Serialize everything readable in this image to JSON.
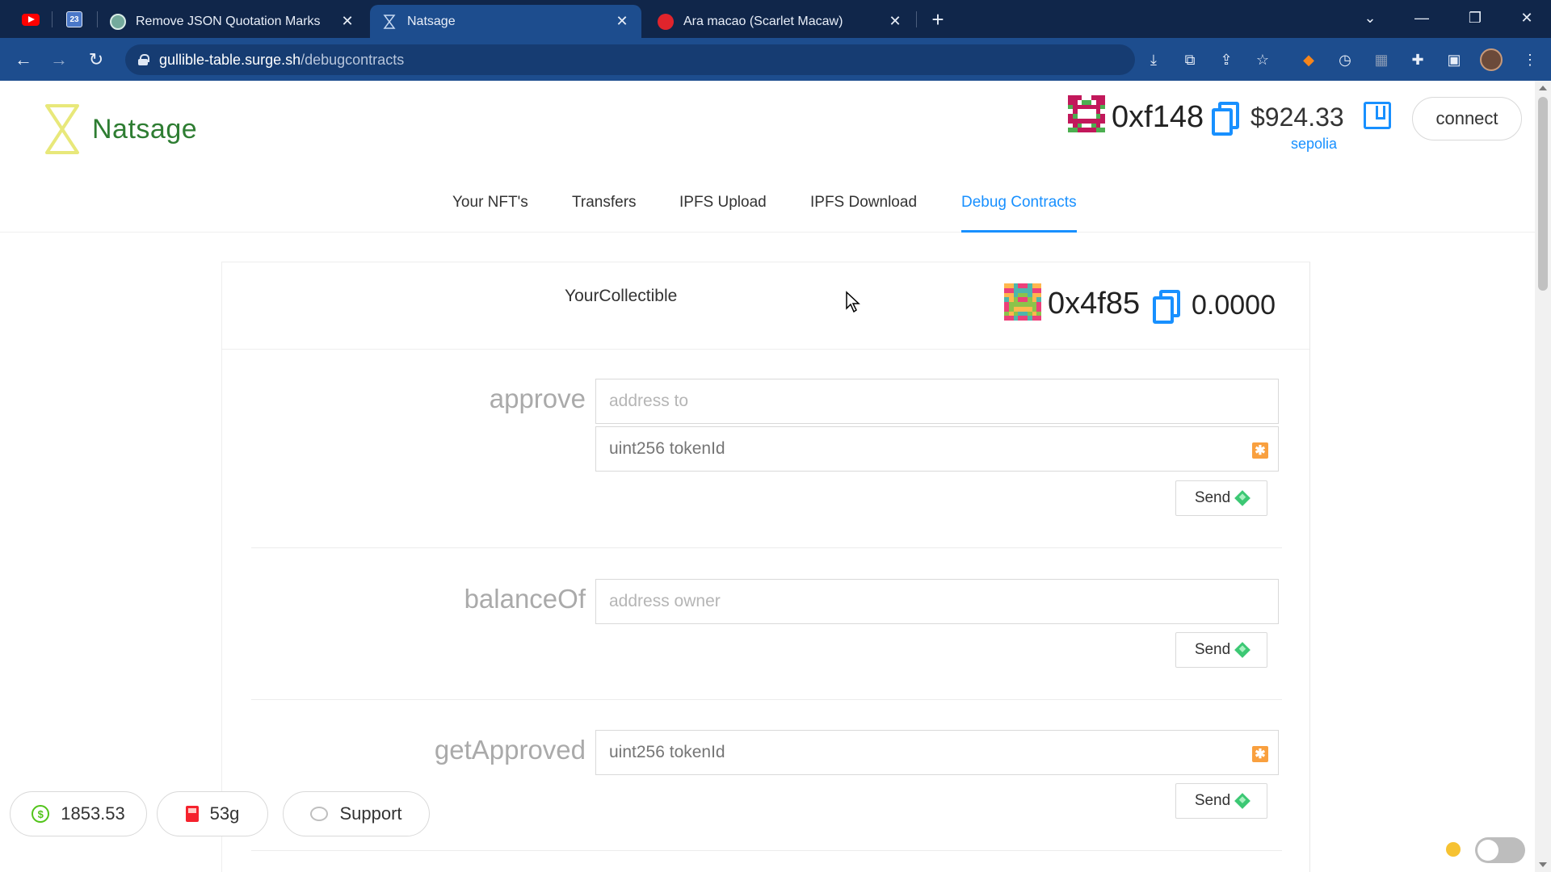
{
  "browser": {
    "tabs": [
      {
        "title": "Remove JSON Quotation Marks",
        "active": false
      },
      {
        "title": "Natsage",
        "active": true
      },
      {
        "title": "Ara macao (Scarlet Macaw)",
        "active": false
      }
    ],
    "pinned_calendar_label": "23",
    "url_host": "gullible-table.surge.sh",
    "url_path": "/debugcontracts"
  },
  "header": {
    "logo_text": "Natsage",
    "account_address": "0xf148",
    "account_balance": "$924.33",
    "network": "sepolia",
    "connect_label": "connect"
  },
  "nav": {
    "items": [
      {
        "label": "Your NFT's",
        "active": false
      },
      {
        "label": "Transfers",
        "active": false
      },
      {
        "label": "IPFS Upload",
        "active": false
      },
      {
        "label": "IPFS Download",
        "active": false
      },
      {
        "label": "Debug Contracts",
        "active": true
      }
    ]
  },
  "contract": {
    "name": "YourCollectible",
    "address": "0x4f85",
    "balance": "0.0000",
    "functions": [
      {
        "name": "approve",
        "inputs": [
          "address to",
          "uint256 tokenId"
        ],
        "send_label": "Send"
      },
      {
        "name": "balanceOf",
        "inputs": [
          "address owner"
        ],
        "send_label": "Send"
      },
      {
        "name": "getApproved",
        "inputs": [
          "uint256 tokenId"
        ],
        "send_label": "Send"
      }
    ]
  },
  "footer": {
    "eth_price": "1853.53",
    "gas_price": "53g",
    "support_label": "Support"
  },
  "colors": {
    "accent": "#1890ff",
    "logo_green": "#2e7d32",
    "tabbar": "#10264a",
    "toolbar": "#1d4d8e"
  }
}
